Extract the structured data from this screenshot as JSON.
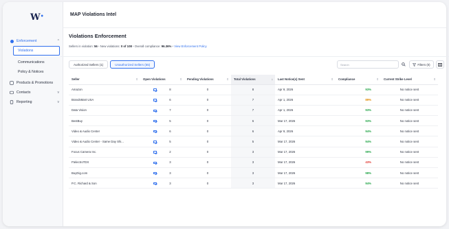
{
  "app": {
    "logo": "W",
    "title": "MAP Violations Intel"
  },
  "sidebar": {
    "enforcement": {
      "label": "Enforcement",
      "chev": "^"
    },
    "violations": "Violations",
    "communications": "Communications",
    "policy": "Policy & Notices",
    "products": "Products & Promotions",
    "contacts": {
      "label": "Contacts",
      "chev": "v"
    },
    "reporting": {
      "label": "Reporting",
      "chev": "v"
    }
  },
  "page": {
    "title": "Violations Enforcement",
    "sellers_label": "Sellers in violation:",
    "sellers_value": "56",
    "new_label": "New violations:",
    "new_value": "0 of 108",
    "compliance_label": "Overall compliance:",
    "compliance_value": "96.36%",
    "policy_link": "View Enforcement Policy"
  },
  "toolbar": {
    "authorized": "Authorized Sellers (1)",
    "unauthorized": "Unauthorized Sellers (55)",
    "search_placeholder": "Search",
    "filters": "Filters (0)"
  },
  "table": {
    "headers": {
      "seller": "Seller",
      "open": "Open Violations",
      "pending": "Pending Violations",
      "total": "Total Violations",
      "last_sent": "Last Notice(s) Sent",
      "compliance": "Compliance",
      "strike": "Current Strike Level"
    },
    "rows": [
      {
        "seller": "Amazon",
        "open": "8",
        "pending": "0",
        "total": "8",
        "last": "Apr 9, 2026",
        "compliance": "93%",
        "ccolor": "#22a447",
        "strike": "No notice sent"
      },
      {
        "seller": "BrandsMart USA",
        "open": "6",
        "pending": "0",
        "total": "7",
        "last": "Apr 1, 2026",
        "compliance": "89%",
        "ccolor": "#e08a00",
        "strike": "No notice sent"
      },
      {
        "seller": "Data Vision",
        "open": "7",
        "pending": "0",
        "total": "7",
        "last": "Apr 1, 2026",
        "compliance": "93%",
        "ccolor": "#22a447",
        "strike": "No notice sent"
      },
      {
        "seller": "BestBuy",
        "open": "5",
        "pending": "0",
        "total": "6",
        "last": "Mar 17, 2026",
        "compliance": "93%",
        "ccolor": "#22a447",
        "strike": "No notice sent"
      },
      {
        "seller": "Video & Audio Center",
        "open": "6",
        "pending": "0",
        "total": "6",
        "last": "Apr 9, 2026",
        "compliance": "94%",
        "ccolor": "#22a447",
        "strike": "No notice sent"
      },
      {
        "seller": "Video & Audio Center - Same Day Shi...",
        "open": "5",
        "pending": "0",
        "total": "5",
        "last": "Mar 17, 2026",
        "compliance": "94%",
        "ccolor": "#22a447",
        "strike": "No notice sent"
      },
      {
        "seller": "Focus Camera Inc.",
        "open": "2",
        "pending": "0",
        "total": "3",
        "last": "Mar 17, 2026",
        "compliance": "99%",
        "ccolor": "#22a447",
        "strike": "No notice sent"
      },
      {
        "seller": "FtelectroTDX",
        "open": "3",
        "pending": "0",
        "total": "3",
        "last": "Mar 17, 2026",
        "compliance": "43%",
        "ccolor": "#e0362f",
        "strike": "No notice sent"
      },
      {
        "seller": "BuyDig.com",
        "open": "3",
        "pending": "0",
        "total": "3",
        "last": "Mar 17, 2026",
        "compliance": "98%",
        "ccolor": "#22a447",
        "strike": "No notice sent"
      },
      {
        "seller": "P.C. Richard & Son",
        "open": "3",
        "pending": "0",
        "total": "3",
        "last": "Mar 17, 2026",
        "compliance": "94%",
        "ccolor": "#22a447",
        "strike": "No notice sent"
      }
    ]
  }
}
